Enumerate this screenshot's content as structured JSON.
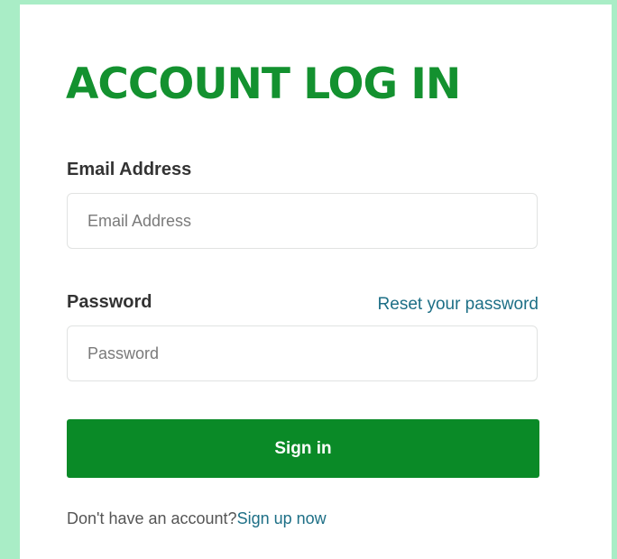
{
  "login": {
    "title": "ACCOUNT LOG IN",
    "email_label": "Email Address",
    "email_placeholder": "Email Address",
    "email_value": "",
    "password_label": "Password",
    "password_placeholder": "Password",
    "password_value": "",
    "reset_link": "Reset your password",
    "signin_label": "Sign in",
    "footer_text": "Don't have an account?",
    "signup_link": "Sign up now"
  },
  "colors": {
    "background": "#a9edc6",
    "accent": "#13912f",
    "button": "#0a8a27",
    "link": "#1d6f86"
  }
}
